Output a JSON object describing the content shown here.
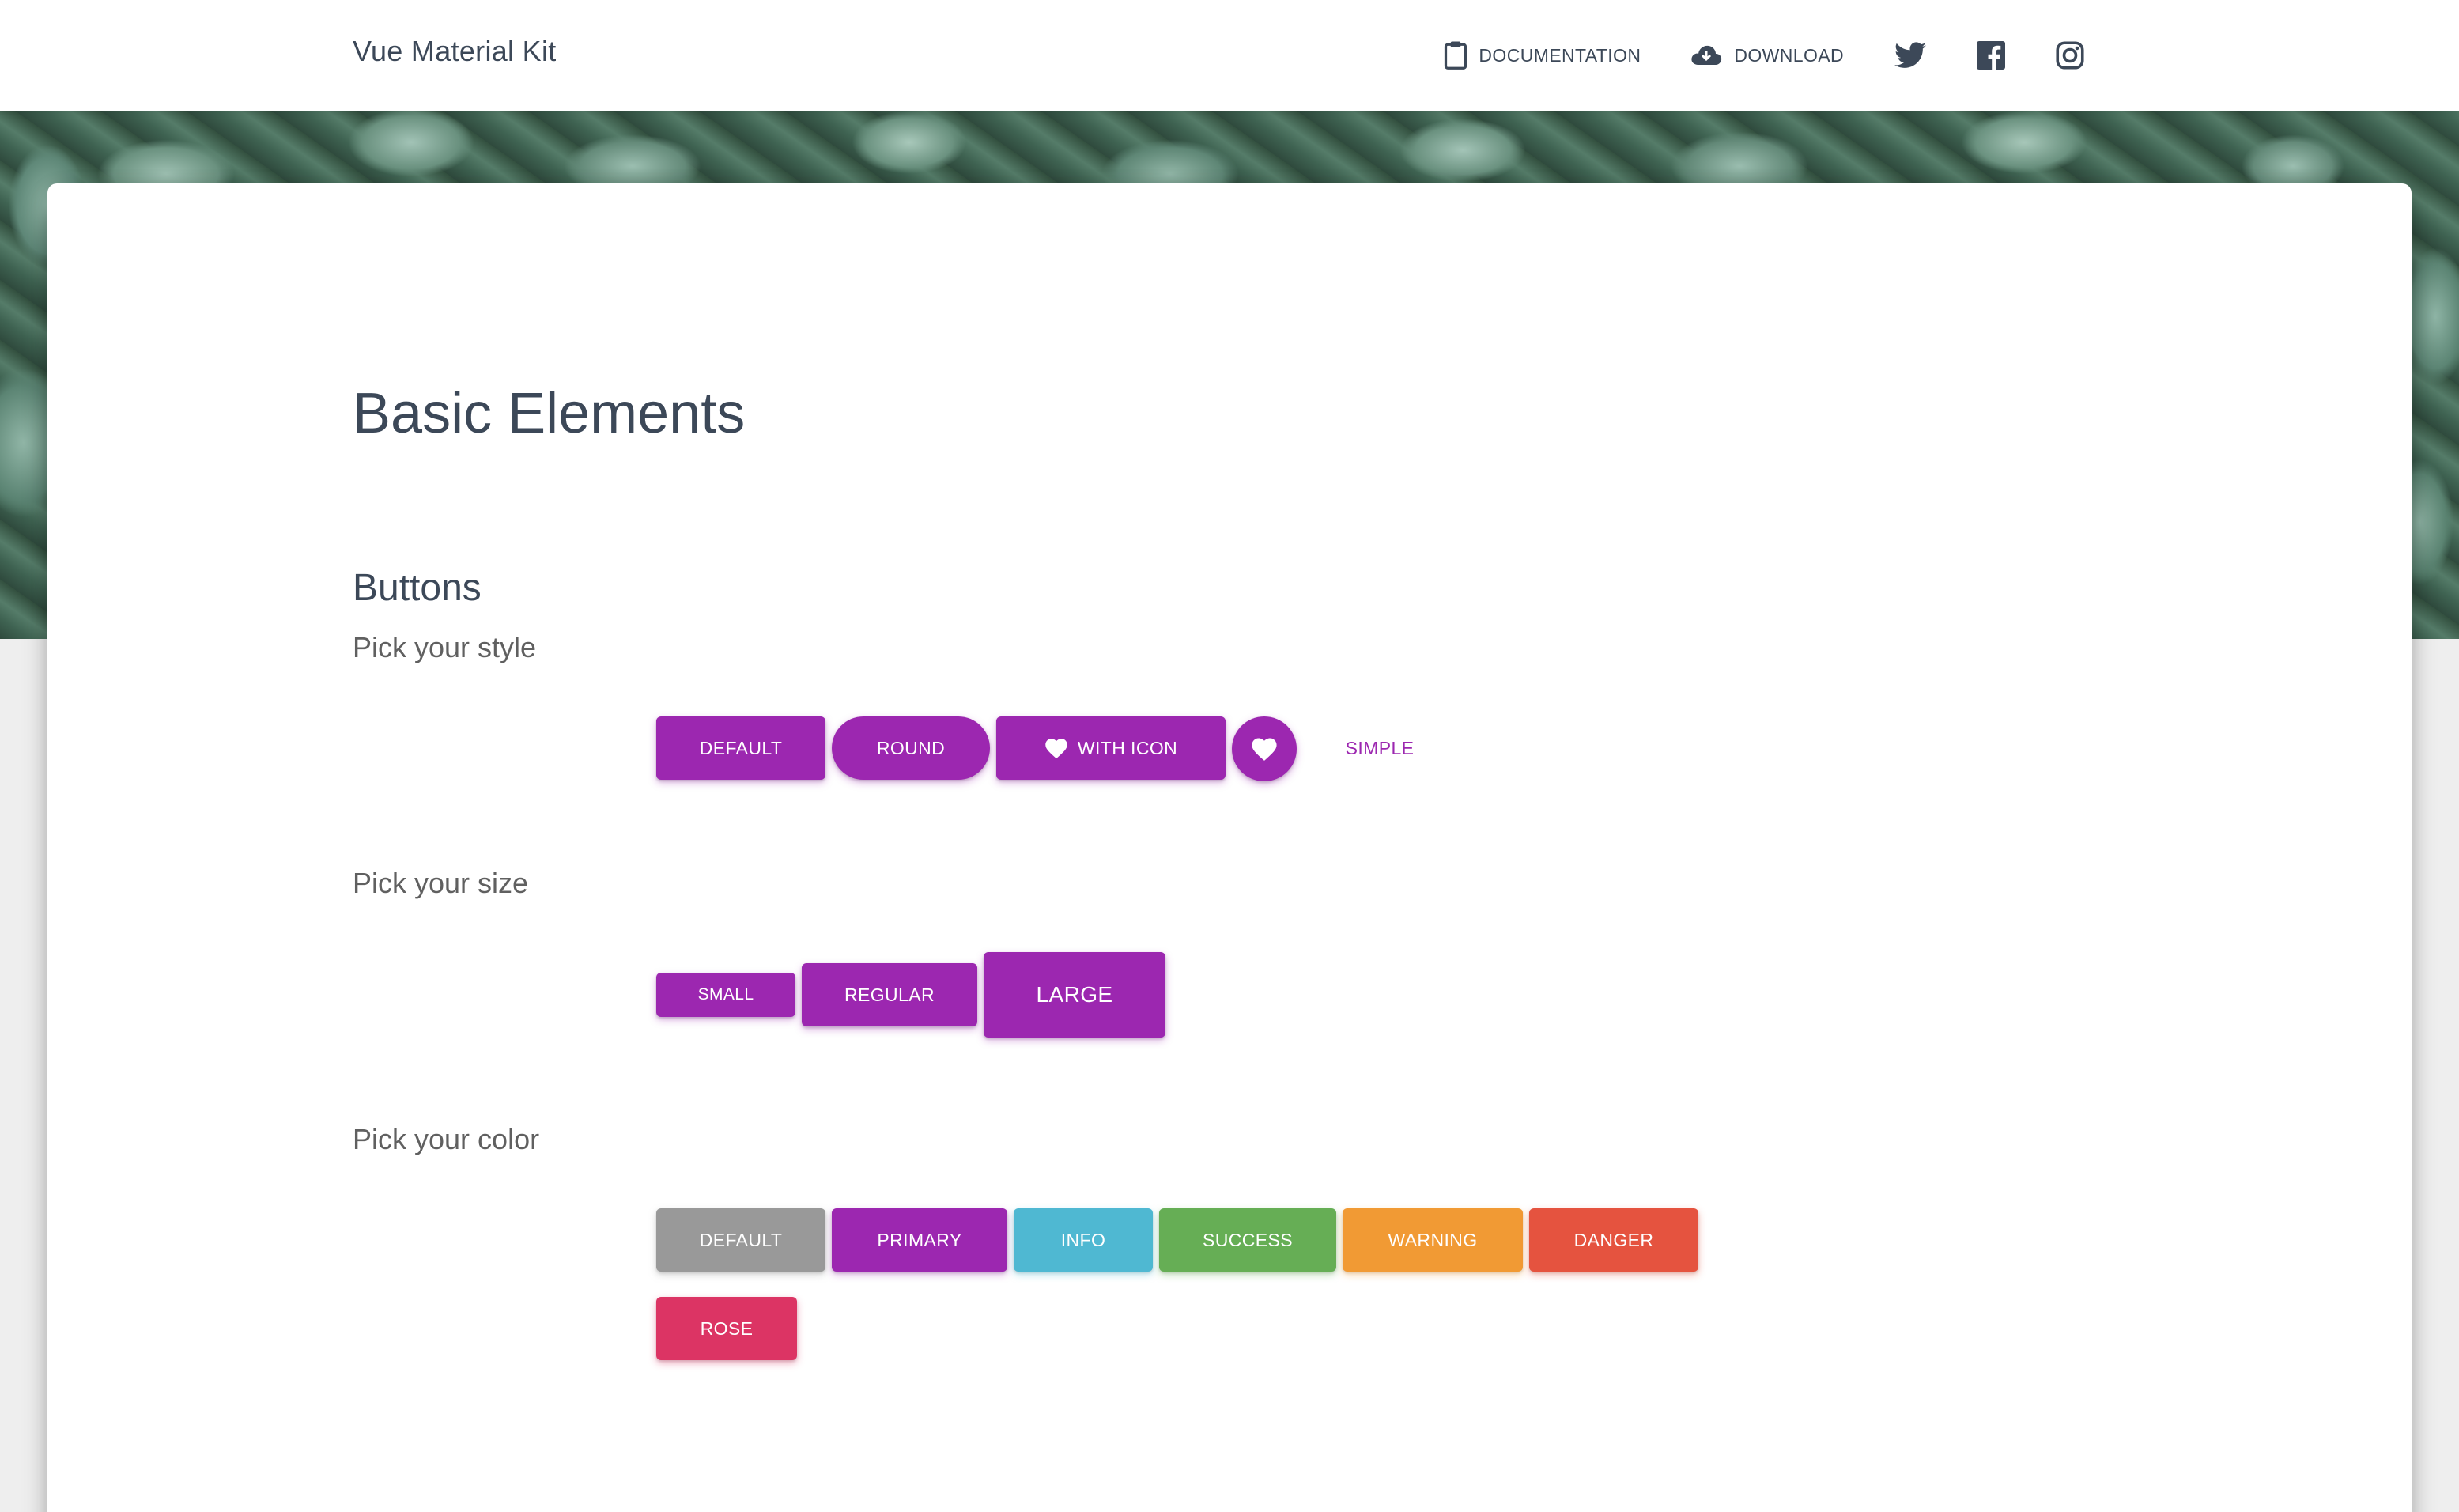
{
  "navbar": {
    "brand": "Vue Material Kit",
    "documentation": "DOCUMENTATION",
    "download": "DOWNLOAD",
    "icons": [
      "clipboard-icon",
      "cloud-download-icon",
      "twitter-icon",
      "facebook-icon",
      "instagram-icon"
    ]
  },
  "content": {
    "page_title": "Basic Elements",
    "section_title": "Buttons",
    "style_title": "Pick your style",
    "size_title": "Pick your size",
    "color_title": "Pick your color"
  },
  "style_buttons": {
    "default": "DEFAULT",
    "round": "ROUND",
    "with_icon": "WITH ICON",
    "simple": "SIMPLE"
  },
  "size_buttons": {
    "small": "SMALL",
    "regular": "REGULAR",
    "large": "LARGE"
  },
  "color_buttons": {
    "default": "DEFAULT",
    "primary": "PRIMARY",
    "info": "INFO",
    "success": "SUCCESS",
    "warning": "WARNING",
    "danger": "DANGER",
    "rose": "ROSE"
  },
  "colors": {
    "default": "#999999",
    "primary": "#9c27b0",
    "info": "#4fb8d2",
    "success": "#66ae55",
    "warning": "#f19a34",
    "danger": "#e5533f",
    "rose": "#dc3464",
    "text": "#3c4858"
  }
}
